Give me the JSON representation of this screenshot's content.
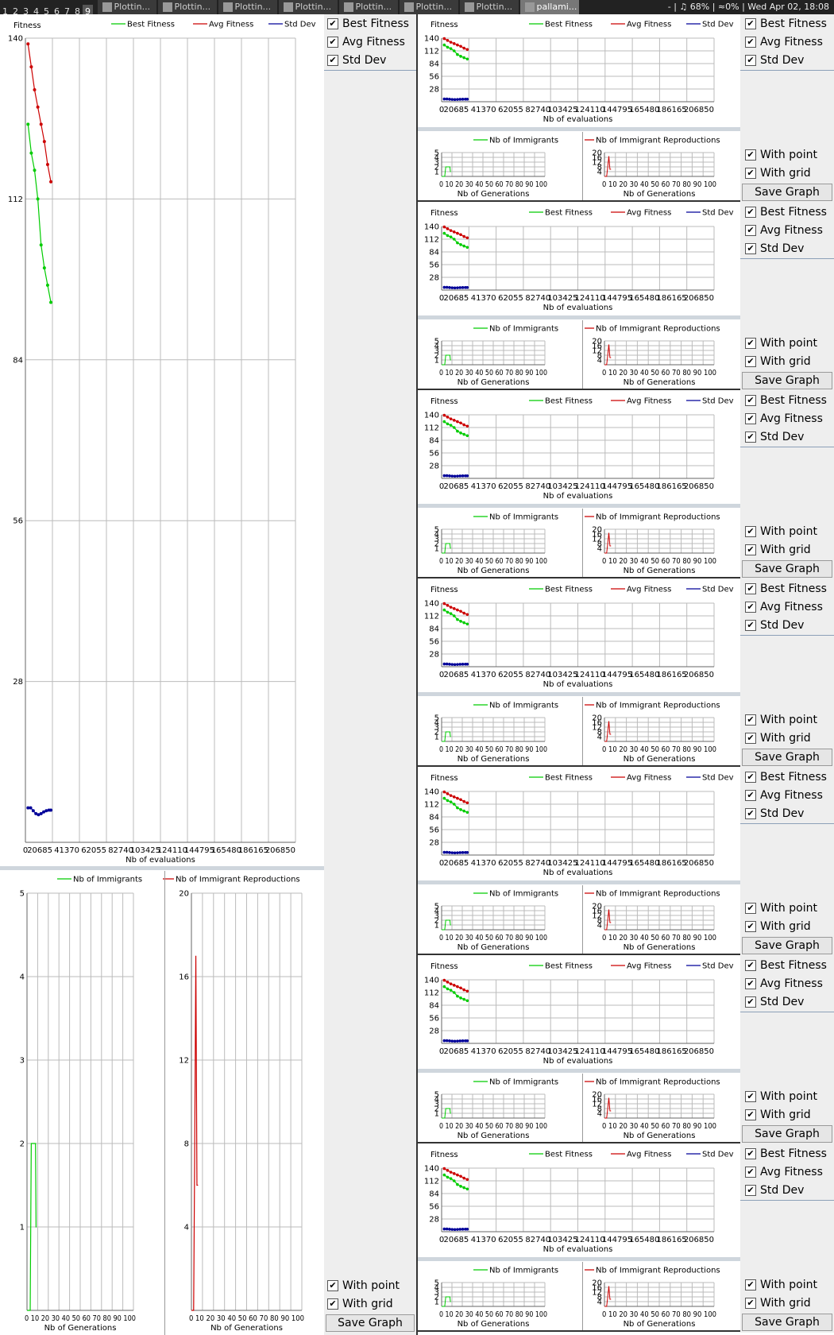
{
  "topbar": {
    "workspaces": [
      "1",
      "2",
      "3",
      "4",
      "5",
      "6",
      "7",
      "8",
      "9"
    ],
    "active_workspace": "9",
    "tasks": [
      "Plottin...",
      "Plottin...",
      "Plottin...",
      "Plottin...",
      "Plottin...",
      "Plottin...",
      "Plottin...",
      "pallami..."
    ],
    "status": "- | ♫ 68% | ≈0% | Wed Apr 02, 18:08"
  },
  "controls": {
    "best_fitness": "Best Fitness",
    "avg_fitness": "Avg Fitness",
    "std_dev": "Std Dev",
    "with_point": "With point",
    "with_grid": "With grid",
    "save_graph": "Save Graph",
    "check": "✔"
  },
  "colors": {
    "best": "#00cc00",
    "avg": "#cc0000",
    "std": "#000099",
    "grid": "#bbbbbb"
  },
  "chart_data": [
    {
      "id": "fitness",
      "type": "line",
      "ylabel": "Fitness",
      "xlabel": "Nb of evaluations",
      "xlim": [
        0,
        206850
      ],
      "ylim": [
        0,
        140
      ],
      "x_ticks": [
        0,
        20685,
        41370,
        62055,
        82740,
        103425,
        124110,
        144795,
        165480,
        186165,
        206850
      ],
      "y_ticks": [
        28,
        56,
        84,
        112,
        140
      ],
      "grid": true,
      "legend_position": "top",
      "series": [
        {
          "name": "Best Fitness",
          "color": "#00cc00",
          "x": [
            2000,
            4500,
            7000,
            9500,
            12000,
            14500,
            17000,
            19500
          ],
          "y": [
            125,
            120,
            117,
            112,
            104,
            100,
            97,
            94
          ]
        },
        {
          "name": "Avg Fitness",
          "color": "#cc0000",
          "x": [
            2000,
            4500,
            7000,
            9500,
            12000,
            14500,
            17000,
            19500
          ],
          "y": [
            139,
            135,
            131,
            128,
            125,
            122,
            118,
            115
          ]
        },
        {
          "name": "Std Dev",
          "color": "#000099",
          "x": [
            2000,
            4000,
            6000,
            8000,
            10000,
            12000,
            14000,
            16000,
            18000,
            19500
          ],
          "y": [
            6,
            6,
            5.5,
            5,
            4.8,
            5,
            5.3,
            5.5,
            5.6,
            5.6
          ]
        }
      ]
    },
    {
      "id": "immigrants",
      "type": "line",
      "xlabel": "Nb of Generations",
      "xlim": [
        0,
        100
      ],
      "ylim": [
        0,
        5
      ],
      "x_ticks": [
        0,
        10,
        20,
        30,
        40,
        50,
        60,
        70,
        80,
        90,
        100
      ],
      "x_tick_labels": "0 10 20 30 40 50 60 70 80 90 100",
      "y_ticks": [
        1,
        2,
        3,
        4,
        5
      ],
      "grid": true,
      "legend_position": "top",
      "series": [
        {
          "name": "Nb of Immigrants",
          "color": "#00cc00",
          "x": [
            0,
            3,
            4,
            5,
            6,
            7,
            8,
            8.5,
            9
          ],
          "y": [
            0,
            0,
            2,
            2,
            2,
            2,
            2,
            1,
            1
          ]
        }
      ]
    },
    {
      "id": "reproductions",
      "type": "line",
      "xlabel": "Nb of Generations",
      "xlim": [
        0,
        100
      ],
      "ylim": [
        0,
        20
      ],
      "x_ticks": [
        0,
        10,
        20,
        30,
        40,
        50,
        60,
        70,
        80,
        90,
        100
      ],
      "x_tick_labels": "0 10 20 30 40 50 60 70 80 90 100",
      "y_ticks": [
        4,
        8,
        12,
        16,
        20
      ],
      "grid": true,
      "legend_position": "top",
      "series": [
        {
          "name": "Nb of Immigrant Reproductions",
          "color": "#cc0000",
          "x": [
            0,
            2,
            3,
            4,
            5,
            6
          ],
          "y": [
            0,
            0,
            8,
            17,
            6,
            6
          ]
        }
      ]
    }
  ]
}
